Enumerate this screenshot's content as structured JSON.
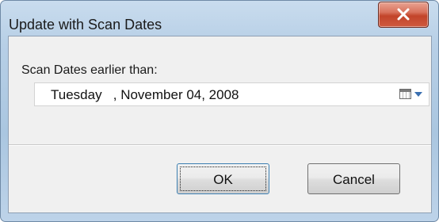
{
  "window": {
    "title": "Update with Scan Dates"
  },
  "form": {
    "label": "Scan Dates earlier than:",
    "date_value": "Tuesday   , November 04, 2008",
    "calendar_icon": "calendar-icon",
    "dropdown_icon": "chevron-down-icon"
  },
  "buttons": {
    "ok_label": "OK",
    "cancel_label": "Cancel"
  },
  "colors": {
    "close_button": "#c2442a",
    "window_frame": "#aac6e0",
    "client_bg": "#f0f0f0"
  }
}
